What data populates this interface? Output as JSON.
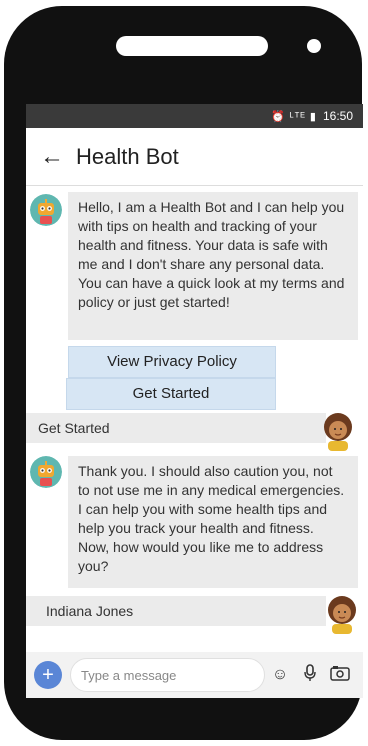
{
  "status": {
    "icons": "⏰ ᴸᵀᴱ ▮",
    "time": "16:50"
  },
  "header": {
    "title": "Health Bot"
  },
  "messages": {
    "bot1": "Hello, I am a Health Bot and I can help you with tips on health and tracking of your health and fitness. Your data is safe with me and I don't share any personal data. You can have a quick look at my terms and policy or just get started!",
    "quick_privacy": "View Privacy Policy",
    "quick_start": "Get Started",
    "user1": "Get Started",
    "bot2": "Thank you.  I should also caution you, not to not use me in any medical emergencies. I can help you with some health tips and help you track your health and fitness. Now, how would you like me to address you?",
    "user2": "Indiana Jones"
  },
  "composer": {
    "placeholder": "Type a message",
    "plus_label": "+"
  },
  "icons": [
    "back-arrow-icon",
    "robot-avatar-icon",
    "user-avatar-icon",
    "smiley-icon",
    "microphone-icon",
    "camera-icon"
  ],
  "colors": {
    "bubble": "#ebebeb",
    "quick_reply": "#d7e6f4",
    "accent": "#5a86d6"
  }
}
